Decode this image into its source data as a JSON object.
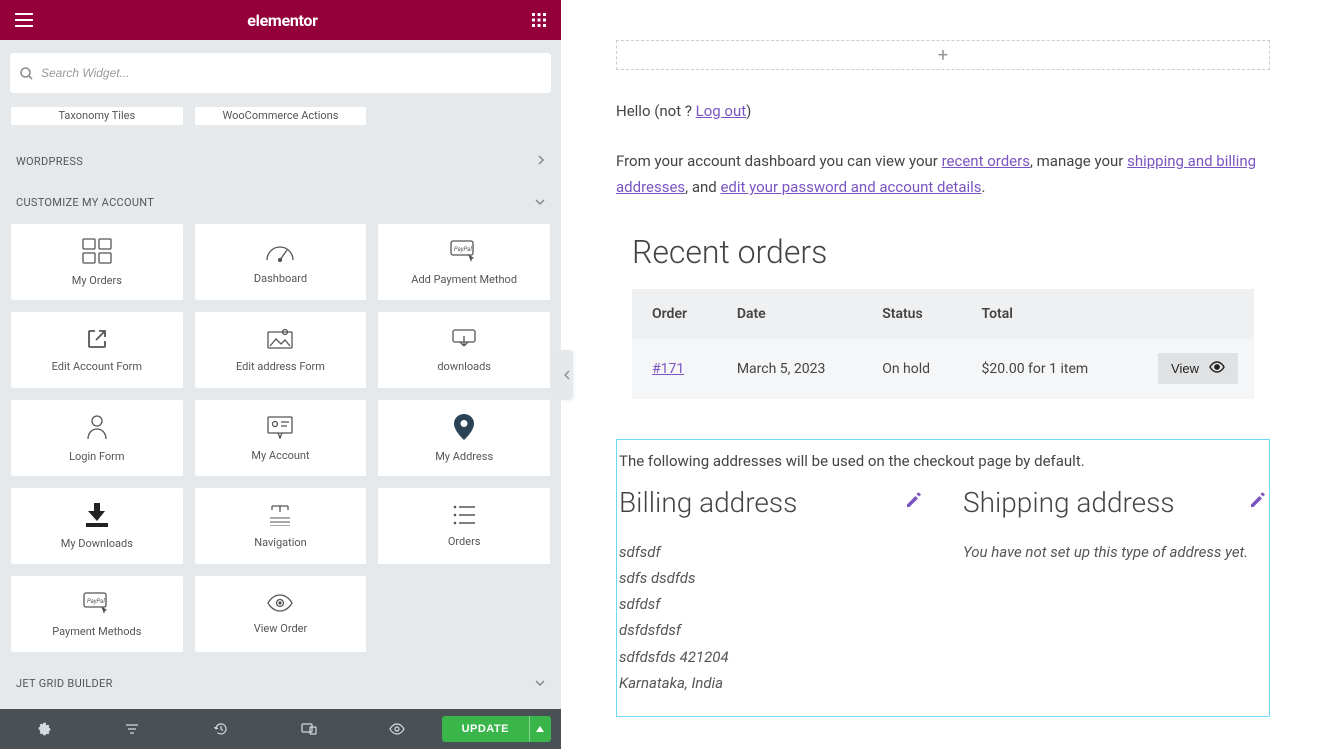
{
  "header": {
    "brand": "elementor"
  },
  "search": {
    "placeholder": "Search Widget..."
  },
  "stubs": {
    "taxonomy": "Taxonomy Tiles",
    "wooactions": "WooCommerce Actions"
  },
  "sections": {
    "wordpress": "WORDPRESS",
    "customize": "CUSTOMIZE MY ACCOUNT",
    "jetgrid": "JET GRID BUILDER"
  },
  "widgets": {
    "my_orders": "My Orders",
    "dashboard": "Dashboard",
    "add_payment": "Add Payment Method",
    "edit_account": "Edit Account Form",
    "edit_address": "Edit address Form",
    "downloads": "downloads",
    "login_form": "Login Form",
    "my_account": "My Account",
    "my_address": "My Address",
    "my_downloads": "My Downloads",
    "navigation": "Navigation",
    "orders": "Orders",
    "payment_methods": "Payment Methods",
    "view_order": "View Order"
  },
  "footer": {
    "update": "UPDATE"
  },
  "preview": {
    "hello_prefix": "Hello (not ? ",
    "logout_link": "Log out",
    "hello_suffix": ")",
    "dash1": "From your account dashboard you can view your ",
    "dash_link1": "recent orders",
    "dash2": ", manage your ",
    "dash_link2": "shipping and billing addresses",
    "dash3": ", and ",
    "dash_link3": "edit your password and account details",
    "dash4": ".",
    "recent_title": "Recent orders",
    "thead": {
      "order": "Order",
      "date": "Date",
      "status": "Status",
      "total": "Total"
    },
    "row": {
      "order": "#171",
      "date": "March 5, 2023",
      "status": "On hold",
      "total": "$20.00 for 1 item"
    },
    "view_btn": "View",
    "addr_intro": "The following addresses will be used on the checkout page by default.",
    "billing_title": "Billing address",
    "shipping_title": "Shipping address",
    "billing_lines": {
      "l1": "sdfsdf",
      "l2": "sdfs dsdfds",
      "l3": "sdfdsf",
      "l4": "dsfdsfdsf",
      "l5": "sdfdsfds 421204",
      "l6": "Karnataka, India"
    },
    "shipping_msg": "You have not set up this type of address yet."
  }
}
